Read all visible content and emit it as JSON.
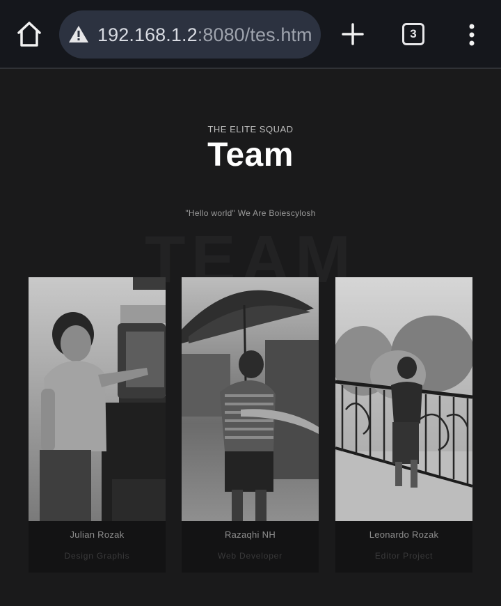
{
  "browser": {
    "url_host": "192.168.1.2",
    "url_port": ":8080/tes.htm",
    "tab_count": "3"
  },
  "section": {
    "eyebrow": "THE ELITE SQUAD",
    "title": "Team",
    "tagline": "\"Hello world\" We Are Boiescylosh",
    "background_word": "TEAM"
  },
  "members": [
    {
      "name": "Julian Rozak",
      "role": "Design Graphis"
    },
    {
      "name": "Razaqhi NH",
      "role": "Web Developer"
    },
    {
      "name": "Leonardo Rozak",
      "role": "Editor Project"
    }
  ],
  "colors": {
    "chrome_bg": "#15171c",
    "urlbar_bg": "#2c3240",
    "page_bg": "#1a1a1b",
    "card_bg": "#131314"
  },
  "icons": [
    "home-icon",
    "warning-icon",
    "plus-icon",
    "tabs-icon",
    "more-vert-icon"
  ]
}
